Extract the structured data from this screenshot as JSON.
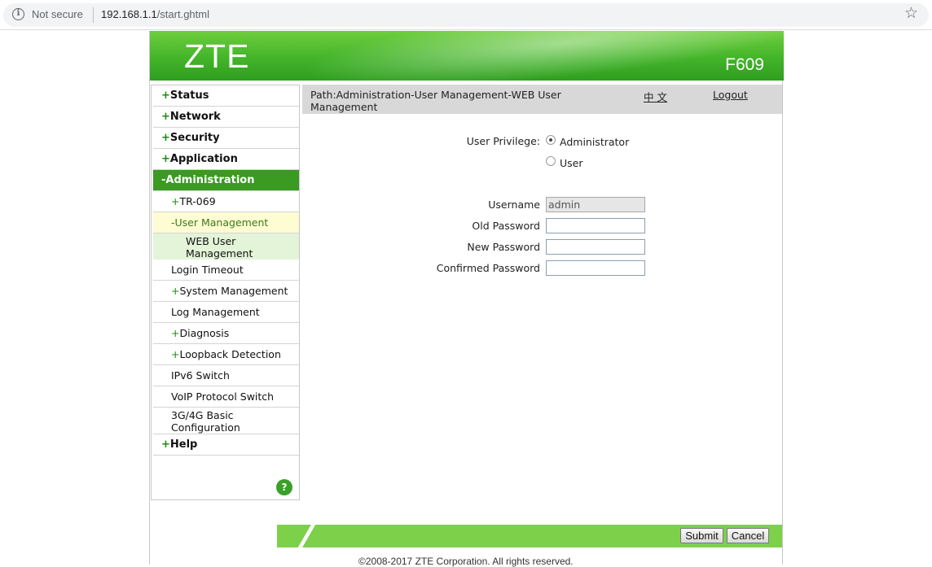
{
  "browser": {
    "security_label": "Not secure",
    "url_host": "192.168.1.1",
    "url_path": "/start.ghtml",
    "info_icon": "info-icon",
    "bookmark_icon": "star-icon"
  },
  "header": {
    "logo": "ZTE",
    "model": "F609",
    "colors": {
      "primary": "#43b42a",
      "light": "#7dd04a"
    }
  },
  "sidebar": {
    "items": [
      {
        "label": "Status",
        "marker": "+"
      },
      {
        "label": "Network",
        "marker": "+"
      },
      {
        "label": "Security",
        "marker": "+"
      },
      {
        "label": "Application",
        "marker": "+"
      },
      {
        "label": "Administration",
        "marker": "-"
      },
      {
        "label": "TR-069",
        "marker": "+"
      },
      {
        "label": "User Management",
        "marker": "-"
      },
      {
        "label": "WEB User Management"
      },
      {
        "label": "Login Timeout"
      },
      {
        "label": "System Management",
        "marker": "+"
      },
      {
        "label": "Log Management"
      },
      {
        "label": "Diagnosis",
        "marker": "+"
      },
      {
        "label": "Loopback Detection",
        "marker": "+"
      },
      {
        "label": "IPv6 Switch"
      },
      {
        "label": "VoIP Protocol Switch"
      },
      {
        "label": "3G/4G Basic Configuration"
      },
      {
        "label": "Help",
        "marker": "+"
      }
    ],
    "help_icon_text": "?"
  },
  "pathbar": {
    "path": "Path:Administration-User Management-WEB User Management",
    "language_link": "中 文",
    "logout_link": "Logout"
  },
  "form": {
    "privilege_label": "User Privilege:",
    "privilege_options": [
      {
        "label": "Administrator",
        "selected": true
      },
      {
        "label": "User",
        "selected": false
      }
    ],
    "username_label": "Username",
    "username_value": "admin",
    "old_password_label": "Old Password",
    "old_password_value": "",
    "new_password_label": "New Password",
    "new_password_value": "",
    "confirmed_password_label": "Confirmed Password",
    "confirmed_password_value": ""
  },
  "footer": {
    "submit_label": "Submit",
    "cancel_label": "Cancel",
    "copyright": "©2008-2017 ZTE Corporation. All rights reserved."
  }
}
